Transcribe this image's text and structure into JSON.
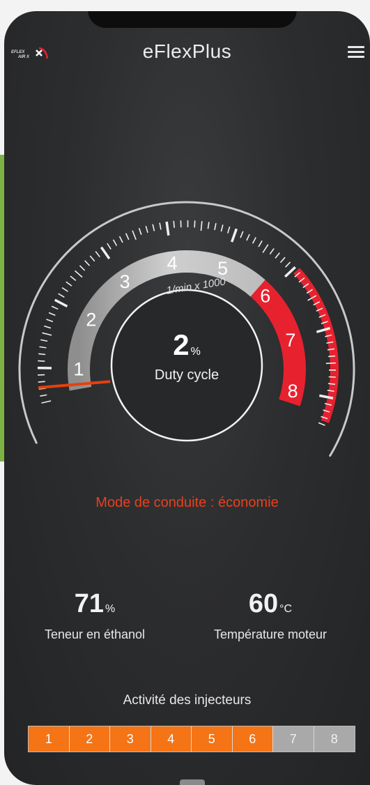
{
  "app": {
    "title": "eFlexPlus",
    "logo_text": "EFLEX",
    "logo_text_2": "AIR X",
    "menu_icon": "hamburger-menu-icon"
  },
  "gauge": {
    "scale_labels": [
      "1",
      "2",
      "3",
      "4",
      "5",
      "6",
      "7",
      "8"
    ],
    "unit_label": "1/min x 1000",
    "value": "2",
    "value_unit": "%",
    "value_label": "Duty cycle",
    "needle_scale_position": 0.8,
    "red_zone_start": 5.8,
    "colors": {
      "accent": "#e8401c",
      "redzone": "#e8212f",
      "needle": "#e8400c"
    }
  },
  "mode": {
    "text": "Mode de conduite : économie"
  },
  "stats": {
    "ethanol": {
      "value": "71",
      "unit": "%",
      "label": "Teneur en éthanol"
    },
    "temperature": {
      "value": "60",
      "unit": "°C",
      "label": "Température moteur"
    }
  },
  "injectors": {
    "title": "Activité des injecteurs",
    "items": [
      {
        "label": "1",
        "active": true
      },
      {
        "label": "2",
        "active": true
      },
      {
        "label": "3",
        "active": true
      },
      {
        "label": "4",
        "active": true
      },
      {
        "label": "5",
        "active": true
      },
      {
        "label": "6",
        "active": true
      },
      {
        "label": "7",
        "active": false
      },
      {
        "label": "8",
        "active": false
      }
    ],
    "active_color": "#f47416",
    "inactive_color": "#a9a9a9"
  }
}
